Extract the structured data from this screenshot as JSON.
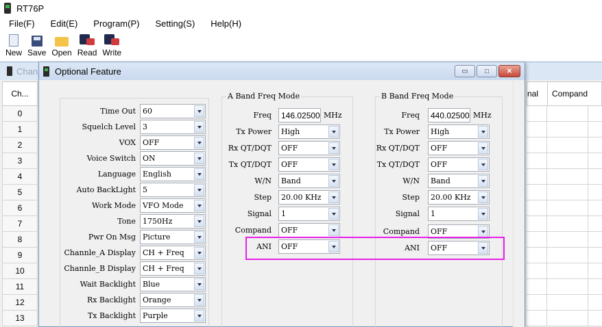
{
  "app": {
    "title": "RT76P"
  },
  "menu": [
    "File(F)",
    "Edit(E)",
    "Program(P)",
    "Setting(S)",
    "Help(H)"
  ],
  "toolbar": [
    {
      "label": "New",
      "icon": "new-file-icon"
    },
    {
      "label": "Save",
      "icon": "save-icon"
    },
    {
      "label": "Open",
      "icon": "open-folder-icon"
    },
    {
      "label": "Read",
      "icon": "read-radio-icon"
    },
    {
      "label": "Write",
      "icon": "write-radio-icon"
    }
  ],
  "channel_window": {
    "title": "Chan",
    "first_header": "Ch...",
    "rows": [
      "0",
      "1",
      "2",
      "3",
      "4",
      "5",
      "6",
      "7",
      "8",
      "9",
      "10",
      "11",
      "12",
      "13"
    ],
    "right_headers": [
      "nal",
      "Compand"
    ]
  },
  "dialog": {
    "title": "Optional Feature",
    "general": [
      {
        "label": "Time Out",
        "value": "60"
      },
      {
        "label": "Squelch Level",
        "value": "3"
      },
      {
        "label": "VOX",
        "value": "OFF"
      },
      {
        "label": "Voice Switch",
        "value": "ON"
      },
      {
        "label": "Language",
        "value": "English"
      },
      {
        "label": "Auto BackLight",
        "value": "5"
      },
      {
        "label": "Work Mode",
        "value": "VFO Mode"
      },
      {
        "label": "Tone",
        "value": "1750Hz"
      },
      {
        "label": "Pwr On Msg",
        "value": "Picture"
      },
      {
        "label": "Channle_A Display",
        "value": "CH + Freq"
      },
      {
        "label": "Channle_B Display",
        "value": "CH + Freq"
      },
      {
        "label": "Wait Backlight",
        "value": "Blue"
      },
      {
        "label": "Rx Backlight",
        "value": "Orange"
      },
      {
        "label": "Tx Backlight",
        "value": "Purple"
      }
    ],
    "a_band": {
      "title": "A Band Freq Mode",
      "freq_label": "Freq",
      "freq": "146.02500",
      "unit": "MHz",
      "fields": [
        {
          "label": "Tx Power",
          "value": "High"
        },
        {
          "label": "Rx QT/DQT",
          "value": "OFF"
        },
        {
          "label": "Tx QT/DQT",
          "value": "OFF"
        },
        {
          "label": "W/N",
          "value": "Band"
        },
        {
          "label": "Step",
          "value": "20.00 KHz"
        },
        {
          "label": "Signal",
          "value": "1"
        },
        {
          "label": "Compand",
          "value": "OFF"
        },
        {
          "label": "ANI",
          "value": "OFF"
        }
      ]
    },
    "b_band": {
      "title": "B Band Freq Mode",
      "freq_label": "Freq",
      "freq": "440.02500",
      "unit": "MHz",
      "fields": [
        {
          "label": "Tx Power",
          "value": "High"
        },
        {
          "label": "Rx QT/DQT",
          "value": "OFF"
        },
        {
          "label": "Tx QT/DQT",
          "value": "OFF"
        },
        {
          "label": "W/N",
          "value": "Band"
        },
        {
          "label": "Step",
          "value": "20.00 KHz"
        },
        {
          "label": "Signal",
          "value": "1"
        },
        {
          "label": "Compand",
          "value": "OFF"
        },
        {
          "label": "ANI",
          "value": "OFF"
        }
      ]
    },
    "window_buttons": {
      "minimize": "▭",
      "maximize": "□",
      "close": "✕"
    }
  },
  "colors": {
    "highlight": "#e81ee8",
    "title_bar": "#dde8f6"
  }
}
